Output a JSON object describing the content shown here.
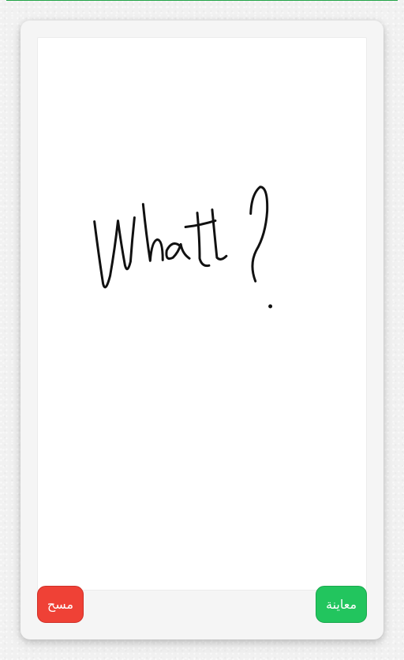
{
  "buttons": {
    "clear_label": "مسح",
    "preview_label": "معاينة"
  },
  "drawing": {
    "handwritten_text": "What?",
    "ink_color": "#111111"
  },
  "colors": {
    "accent": "#22a447",
    "clear_button": "#ef4136",
    "preview_button": "#22c55e"
  }
}
